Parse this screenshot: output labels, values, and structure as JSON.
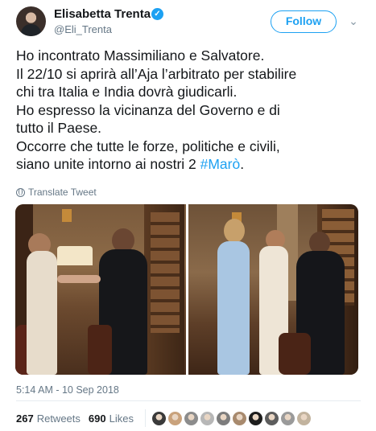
{
  "header": {
    "display_name": "Elisabetta Trenta",
    "handle": "@Eli_Trenta",
    "follow_label": "Follow",
    "verified_icon": "verified-badge-icon",
    "menu_icon": "chevron-down-icon"
  },
  "tweet": {
    "lines": [
      "Ho incontrato Massimiliano e Salvatore.",
      "Il 22/10 si aprirà all’Aja l’arbitrato per stabilire",
      "chi tra Italia e India dovrà giudicarli.",
      "Ho espresso la vicinanza del Governo e di",
      "tutto il Paese.",
      "Occorre che tutte le forze, politiche e civili,"
    ],
    "last_line_prefix": "siano unite intorno ai nostri 2 ",
    "hashtag": "#Marò",
    "last_line_suffix": "."
  },
  "translate_label": "Translate Tweet",
  "timestamp": "5:14 AM - 10 Sep 2018",
  "stats": {
    "retweets_count": "267",
    "retweets_label": "Retweets",
    "likes_count": "690",
    "likes_label": "Likes"
  },
  "colors": {
    "accent": "#1da1f2",
    "secondary_text": "#657786",
    "primary_text": "#14171a"
  },
  "liker_avatar_colors": [
    "#3a3a3a",
    "#c9a27c",
    "#8c8c8c",
    "#b7b7b7",
    "#7d7d7d",
    "#a88a6e",
    "#1d1d1d",
    "#5d5d5d",
    "#9a9a9a",
    "#c2b39e"
  ]
}
